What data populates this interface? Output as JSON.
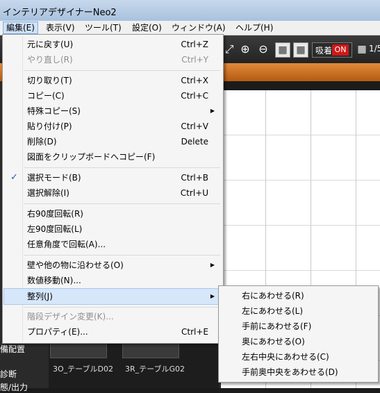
{
  "window": {
    "title": "インテリアデザイナーNeo2"
  },
  "menubar": [
    "編集(E)",
    "表示(V)",
    "ツール(T)",
    "設定(O)",
    "ウィンドウ(A)",
    "ヘルプ(H)"
  ],
  "toolbar": {
    "snap_label": "吸着",
    "snap_state": "ON",
    "page": "1/5"
  },
  "edit_menu": {
    "undo": "元に戻す(U)",
    "undo_sc": "Ctrl+Z",
    "redo": "やり直し(R)",
    "redo_sc": "Ctrl+Y",
    "cut": "切り取り(T)",
    "cut_sc": "Ctrl+X",
    "copy": "コピー(C)",
    "copy_sc": "Ctrl+C",
    "special_copy": "特殊コピー(S)",
    "paste": "貼り付け(P)",
    "paste_sc": "Ctrl+V",
    "delete": "削除(D)",
    "delete_sc": "Delete",
    "copy_to_clipboard": "図面をクリップボードへコピー(F)",
    "select_mode": "選択モード(B)",
    "select_mode_sc": "Ctrl+B",
    "deselect": "選択解除(I)",
    "deselect_sc": "Ctrl+U",
    "rotate_right": "右90度回転(R)",
    "rotate_left": "左90度回転(L)",
    "rotate_any": "任意角度で回転(A)...",
    "align_wall": "壁や他の物に沿わせる(O)",
    "numeric_move": "数値移動(N)...",
    "align": "整列(J)",
    "stair_design": "階段デザイン変更(K)...",
    "properties": "プロパティ(E)...",
    "properties_sc": "Ctrl+E"
  },
  "align_submenu": [
    "右にあわせる(R)",
    "左にあわせる(L)",
    "手前にあわせる(F)",
    "奥にあわせる(O)",
    "左右中央にあわせる(C)",
    "手前奥中央をあわせる(D)"
  ],
  "background": {
    "left_labels": [
      "備配置",
      "診断",
      "態/出力"
    ],
    "thumb1": "3O_テーブルD02",
    "thumb2": "3R_テーブルG02"
  },
  "colors": {
    "snap_on": "#d01818",
    "toolbar_orange": "#e08a3a",
    "check": "#1d55b3"
  }
}
